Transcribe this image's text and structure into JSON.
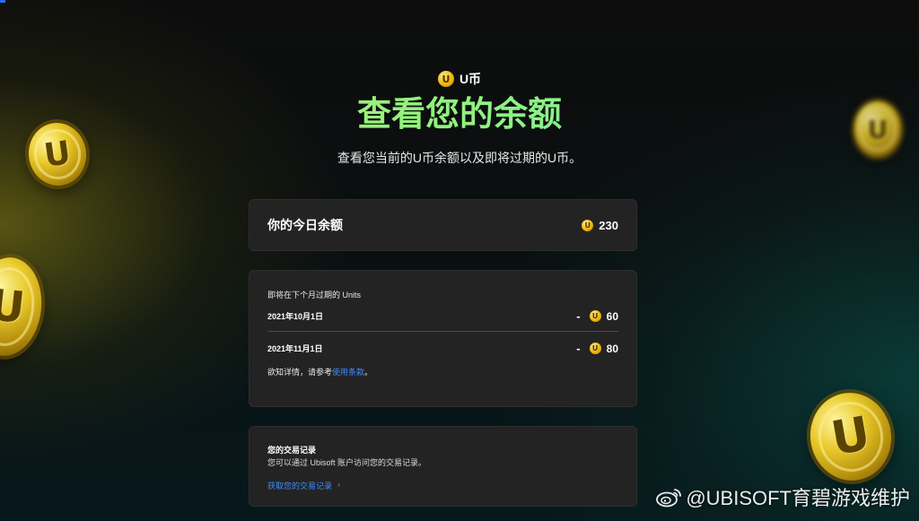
{
  "header": {
    "eyebrow_icon": "u-coin-icon",
    "eyebrow": "U币",
    "title": "查看您的余额",
    "subtitle": "查看您当前的U币余额以及即将过期的U币。"
  },
  "balance": {
    "label": "你的今日余额",
    "amount": "230"
  },
  "expiry": {
    "heading": "即将在下个月过期的 Units",
    "rows": [
      {
        "date": "2021年10月1日",
        "sign": "-",
        "amount": "60"
      },
      {
        "date": "2021年11月1日",
        "sign": "-",
        "amount": "80"
      }
    ],
    "note_prefix": "欲知详情，请参考",
    "note_link": "使用条款",
    "note_suffix": "。"
  },
  "history": {
    "title": "您的交易记录",
    "desc": "您可以通过 Ubisoft 账户访问您的交易记录。",
    "link": "获取您的交易记录",
    "chevron": "›"
  },
  "coin_letter": "U",
  "watermark": "@UBISOFT育碧游戏维护",
  "colors": {
    "title_gradient_start": "#c6f26a",
    "title_gradient_end": "#78efb0",
    "link": "#3f8cff",
    "card_bg": "#232323",
    "coin_gold": "#e8c92a"
  }
}
